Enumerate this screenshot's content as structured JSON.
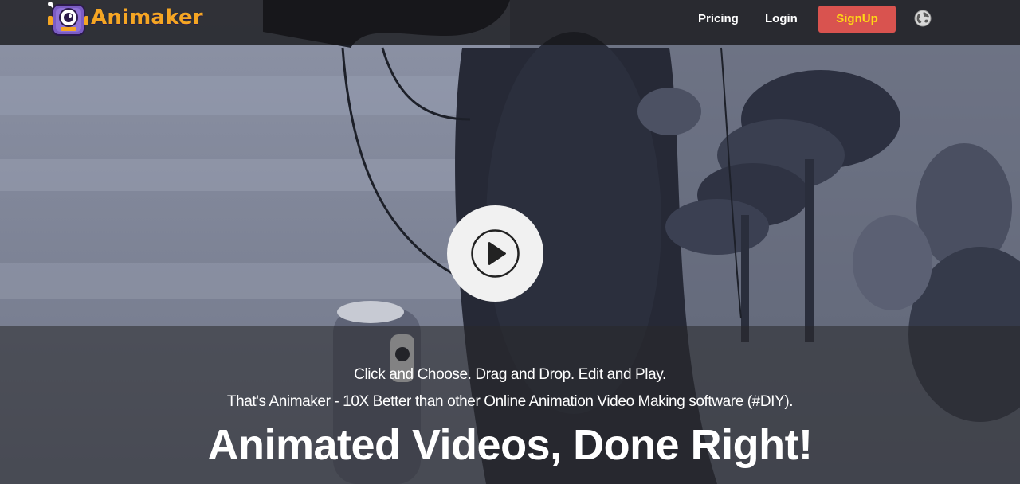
{
  "brand": {
    "name": "Animaker",
    "logo_icon": "robot-mascot-icon",
    "accent": "#f5a623"
  },
  "nav": {
    "pricing_label": "Pricing",
    "login_label": "Login",
    "signup_label": "SignUp",
    "signup_bg": "#d9534f",
    "signup_text_color": "#ffd814",
    "language_icon": "globe-icon"
  },
  "hero": {
    "play_icon": "play-icon",
    "tagline_line1": "Click and Choose. Drag and Drop. Edit and Play.",
    "tagline_line2": "That's Animaker - 10X Better than other Online Animation Video Making software (#DIY).",
    "headline": "Animated Videos, Done Right!"
  }
}
